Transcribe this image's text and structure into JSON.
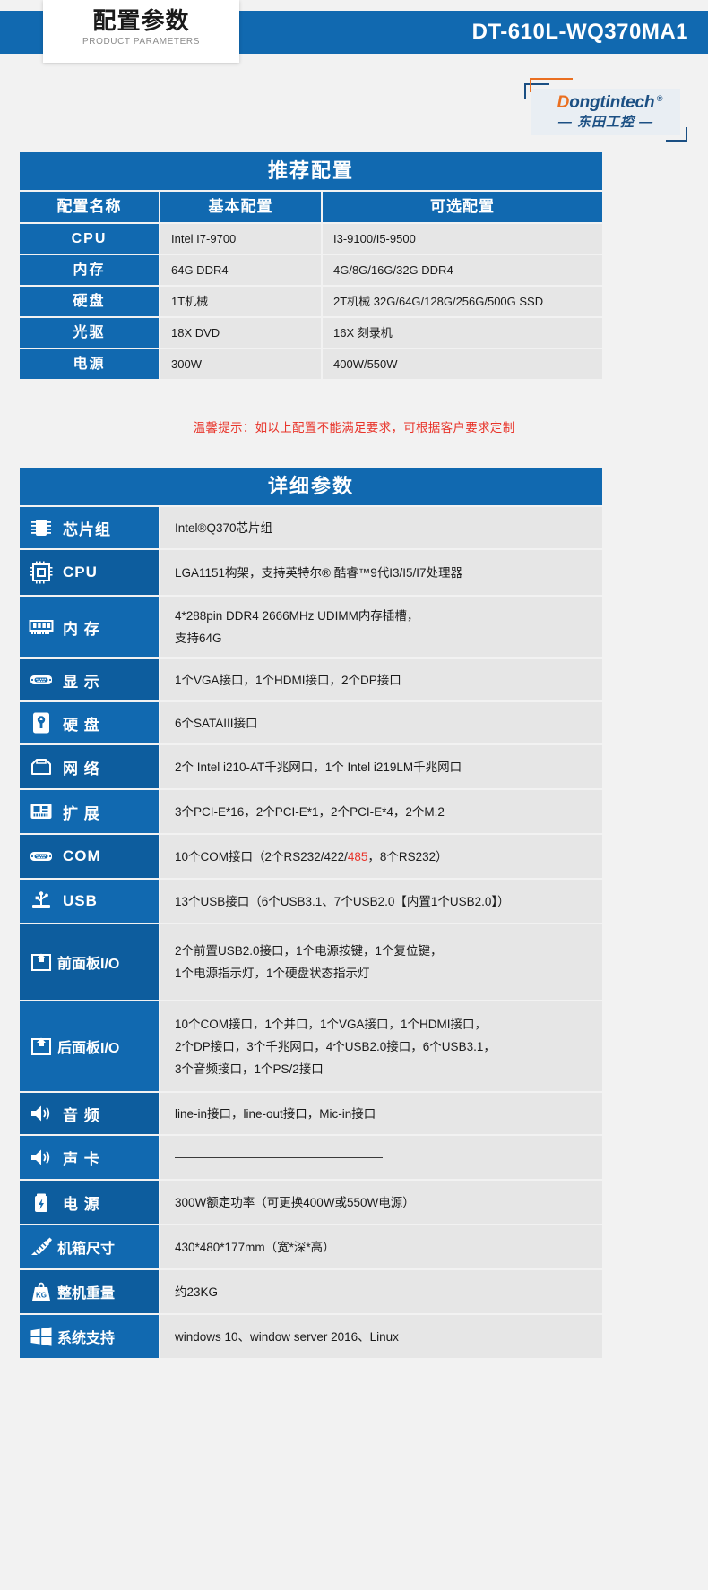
{
  "header": {
    "plate_title_cn": "配置参数",
    "plate_title_en": "PRODUCT PARAMETERS",
    "model": "DT-610L-WQ370MA1",
    "band_color": "#1169b0"
  },
  "logo": {
    "brand_en_lead": "D",
    "brand_en_rest": "ongtintech",
    "registered_mark": "®",
    "brand_cn": "— 东田工控 —",
    "accent_color": "#ea6f20",
    "text_color": "#1b4f83"
  },
  "recommended_table": {
    "title": "推荐配置",
    "columns": [
      "配置名称",
      "基本配置",
      "可选配置"
    ],
    "rows": [
      {
        "name": "CPU",
        "basic": "Intel I7-9700",
        "optional": "I3-9100/I5-9500"
      },
      {
        "name": "内存",
        "basic": "64G DDR4",
        "optional": "4G/8G/16G/32G DDR4"
      },
      {
        "name": "硬盘",
        "basic": "1T机械",
        "optional": "2T机械 32G/64G/128G/256G/500G SSD"
      },
      {
        "name": "光驱",
        "basic": "18X DVD",
        "optional": "16X 刻录机"
      },
      {
        "name": "电源",
        "basic": "300W",
        "optional": "400W/550W"
      }
    ]
  },
  "notice": "温馨提示：如以上配置不能满足要求，可根据客户要求定制",
  "detail_table": {
    "title": "详细参数",
    "rows": [
      {
        "icon": "chipset-icon",
        "label": "芯片组",
        "lines": [
          "Intel®Q370芯片组"
        ]
      },
      {
        "icon": "cpu-icon",
        "label": "CPU",
        "lines": [
          "LGA1151构架，支持英特尔® 酷睿™9代I3/I5/I7处理器"
        ]
      },
      {
        "icon": "memory-icon",
        "label": "内 存",
        "lines": [
          "4*288pin DDR4 2666MHz UDIMM内存插槽，",
          "支持64G"
        ]
      },
      {
        "icon": "display-vga-icon",
        "label": "显 示",
        "lines": [
          "1个VGA接口，1个HDMI接口，2个DP接口"
        ]
      },
      {
        "icon": "harddisk-icon",
        "label": "硬 盘",
        "lines": [
          "6个SATAIII接口"
        ]
      },
      {
        "icon": "network-icon",
        "label": "网 络",
        "lines": [
          "2个 Intel i210-AT千兆网口，1个 Intel i219LM千兆网口"
        ]
      },
      {
        "icon": "expansion-icon",
        "label": "扩 展",
        "lines": [
          "3个PCI-E*16，2个PCI-E*1，2个PCI-E*4，2个M.2"
        ]
      },
      {
        "icon": "com-port-icon",
        "label": "COM",
        "lines": [
          "10个COM接口（2个RS232/422/485，8个RS232）"
        ],
        "highlight": "485"
      },
      {
        "icon": "usb-icon",
        "label": "USB",
        "lines": [
          "13个USB接口（6个USB3.1、7个USB2.0【内置1个USB2.0】）"
        ]
      },
      {
        "icon": "front-panel-icon",
        "label": "前面板I/O",
        "lines": [
          "2个前置USB2.0接口，1个电源按键，1个复位键，",
          "1个电源指示灯，1个硬盘状态指示灯"
        ]
      },
      {
        "icon": "rear-panel-icon",
        "label": "后面板I/O",
        "lines": [
          "10个COM接口，1个并口，1个VGA接口，1个HDMI接口，",
          "2个DP接口，3个千兆网口，4个USB2.0接口，6个USB3.1，",
          "3个音频接口，1个PS/2接口"
        ]
      },
      {
        "icon": "audio-icon",
        "label": "音 频",
        "lines": [
          "line-in接口，line-out接口，Mic-in接口"
        ]
      },
      {
        "icon": "soundcard-icon",
        "label": "声 卡",
        "lines": [
          ""
        ]
      },
      {
        "icon": "power-icon",
        "label": "电 源",
        "lines": [
          "300W额定功率（可更换400W或550W电源）"
        ]
      },
      {
        "icon": "dimension-icon",
        "label": "机箱尺寸",
        "lines": [
          "430*480*177mm（宽*深*高）"
        ]
      },
      {
        "icon": "weight-icon",
        "label": "整机重量",
        "lines": [
          "约23KG"
        ]
      },
      {
        "icon": "windows-icon",
        "label": "系统支持",
        "lines": [
          "windows 10、window server 2016、Linux"
        ]
      }
    ]
  },
  "colors": {
    "brand_blue": "#1169b0",
    "dark_blue": "#0d5d9e",
    "cell_grey": "#e6e6e6",
    "page_bg": "#f2f2f2",
    "alert_red": "#e8342a"
  }
}
